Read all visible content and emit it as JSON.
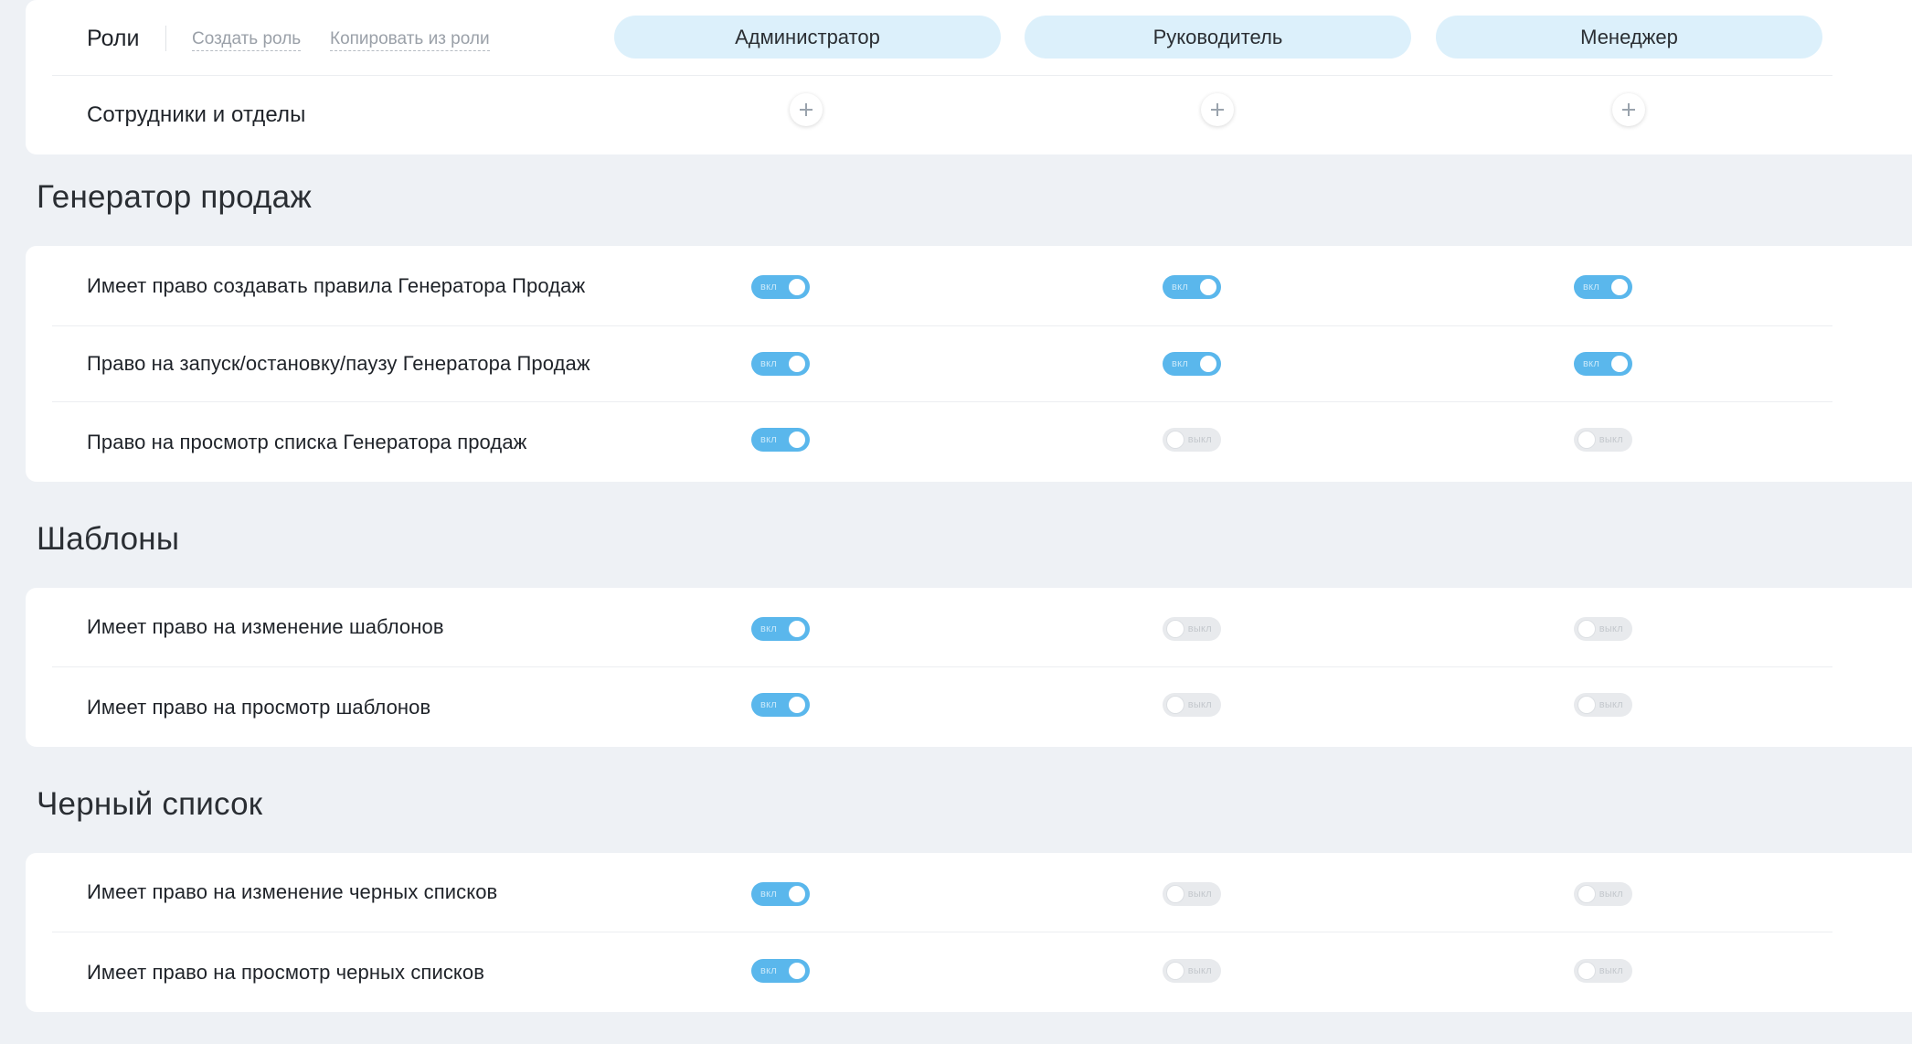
{
  "header": {
    "title": "Роли",
    "create_role": "Создать роль",
    "copy_from_role": "Копировать из роли",
    "roles": [
      "Администратор",
      "Руководитель",
      "Менеджер"
    ],
    "employees_label": "Сотрудники и отделы",
    "add_icon": "plus-icon"
  },
  "sections": [
    {
      "title": "Генератор продаж",
      "rows": [
        {
          "label": "Имеет право создавать правила Генератора Продаж",
          "values": [
            true,
            true,
            true
          ]
        },
        {
          "label": "Право на запуск/остановку/паузу Генератора Продаж",
          "values": [
            true,
            true,
            true
          ]
        },
        {
          "label": "Право на просмотр списка Генератора продаж",
          "values": [
            true,
            false,
            false
          ]
        }
      ]
    },
    {
      "title": "Шаблоны",
      "rows": [
        {
          "label": "Имеет право на изменение шаблонов",
          "values": [
            true,
            false,
            false
          ]
        },
        {
          "label": "Имеет право на просмотр шаблонов",
          "values": [
            true,
            false,
            false
          ]
        }
      ]
    },
    {
      "title": "Черный список",
      "rows": [
        {
          "label": "Имеет право на изменение черных списков",
          "values": [
            true,
            false,
            false
          ]
        },
        {
          "label": "Имеет право на просмотр черных списков",
          "values": [
            true,
            false,
            false
          ]
        }
      ]
    }
  ],
  "toggle_labels": {
    "on": "вкл",
    "off": "выкл"
  },
  "colors": {
    "toggle_on": "#5ab7ec",
    "toggle_off": "#e8eaed",
    "role_pill": "#dcf0fb",
    "background": "#eef1f5"
  }
}
